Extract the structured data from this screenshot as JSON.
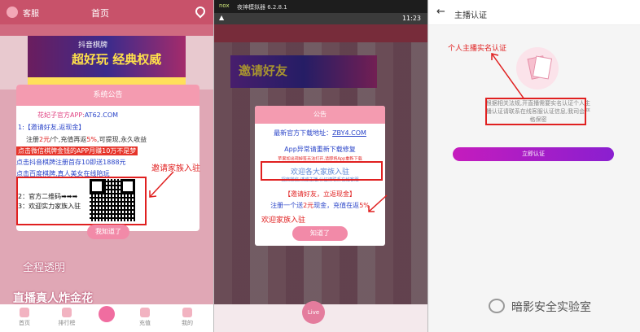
{
  "panel1": {
    "app_name": "客服",
    "title": "首页",
    "banner_top": "抖音棋牌",
    "banner_main": "超好玩 经典权威",
    "big_text": "全程透明",
    "bottom_text": "直播真人炸金花",
    "dialog": {
      "header": "系统公告",
      "site_label": "花妃子官方APP:",
      "site_value": "AT62.COM",
      "invite_title": "1:【邀请好友,返现金】",
      "line1_prefix": "注册",
      "line1_highlight": "2元",
      "line1_mid": "/个,充值再返",
      "line1_highlight2": "5%",
      "line1_suffix": ",可提现,永久收益",
      "line2": "点击微信棋牌金钱的APP月赚10万不是梦",
      "line3": "点击抖音棋牌注册首存10即送1888元",
      "line4": "点击百度棋牌,真人美女在线陪玩",
      "qr_line1": "2：官方二维码➡➡➡",
      "qr_line2": "3：欢迎实力家族入驻",
      "ok_button": "我知道了"
    },
    "annotation": "邀请家族入驻",
    "nav": [
      "首页",
      "排行榜",
      "",
      "充值",
      "我的"
    ]
  },
  "panel2": {
    "status_app": "夜神模拟器 6.2.8.1",
    "status_time": "11:23",
    "dialog": {
      "header": "公告",
      "download_label": "最新官方下载地址：",
      "download_value": "ZBY4.COM",
      "fix_title": "App异常请重新下载修复",
      "fix_desc": "苹果如出现掉签无法打开,请即将App重新下载",
      "welcome": "欢迎各大家族入驻",
      "welcome_sub": "招商微信,诱惑主播,认证请联系在线客服",
      "invite_title": "【邀请好友，立返现金】",
      "invite_prefix": "注册一个送",
      "invite_amount": "2元",
      "invite_mid": "现金，充值在返",
      "invite_pct": "5%",
      "ok_button": "知道了"
    },
    "annotation": "欢迎家族入驻",
    "nav": [
      "首页",
      "",
      "Live",
      "",
      "我的"
    ]
  },
  "panel3": {
    "back_icon": "←",
    "title": "主播认证",
    "annotation": "个人主播实名认证",
    "description": "根据相关法规,开直播需要实名认证个人主播认证请联系在线客服认证信息,我司会严格保密",
    "button": "立即认证"
  },
  "watermark": "暗影安全实验室",
  "colors": {
    "pink_header": "#f49bb0",
    "red_annotation": "#e02020",
    "purple_button": "#a91fc8"
  }
}
